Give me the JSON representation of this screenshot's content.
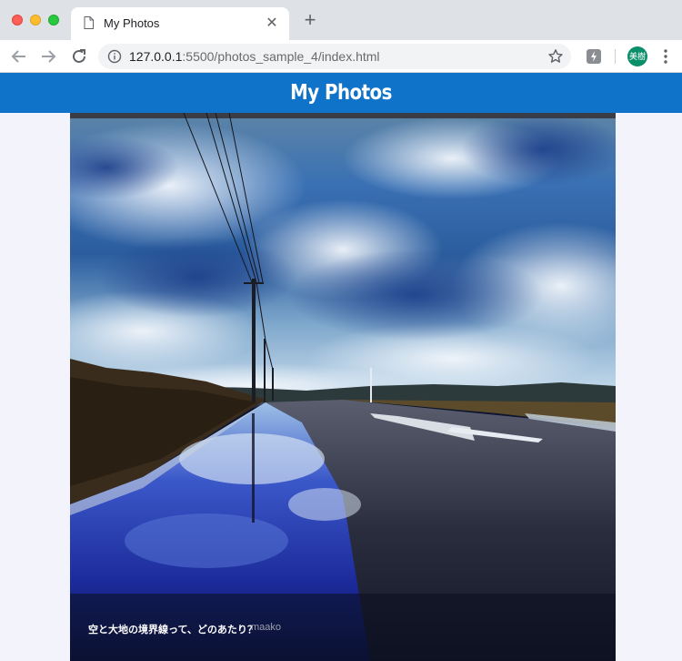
{
  "browser": {
    "tab": {
      "title": "My Photos",
      "close_glyph": "✕",
      "icon": "page-icon"
    },
    "new_tab_glyph": "+",
    "address": {
      "host": "127.0.0.1",
      "rest": ":5500/photos_sample_4/index.html"
    },
    "profile_avatar_text": "美樹",
    "icons": [
      "back-arrow-icon",
      "forward-arrow-icon",
      "reload-icon",
      "info-icon",
      "star-icon",
      "extension-icon",
      "menu-icon"
    ]
  },
  "site": {
    "title": "My Photos",
    "header_color": "#0f73c9"
  },
  "photo": {
    "caption_title": "空と大地の境界線って、どのあたり？",
    "caption_author": "maako"
  }
}
